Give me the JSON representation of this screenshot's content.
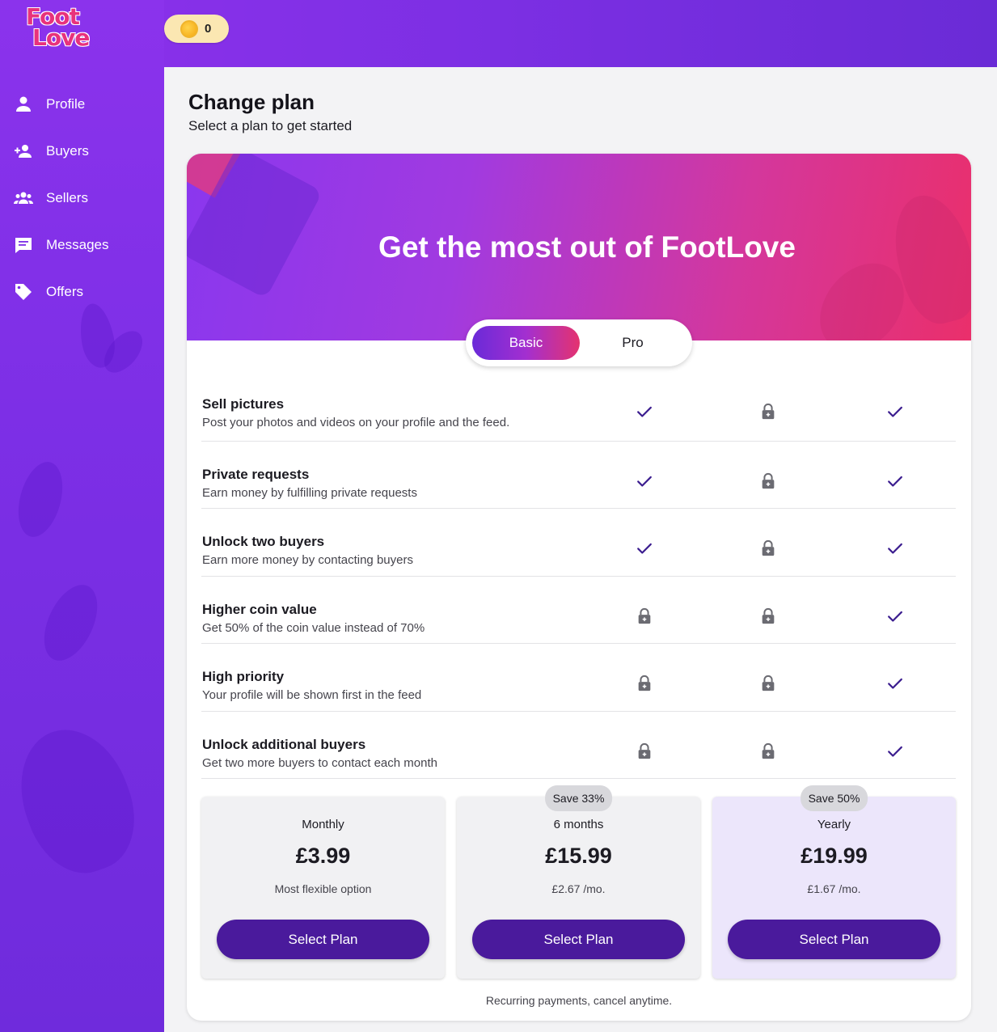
{
  "app": {
    "logo_line1": "Foot",
    "logo_line2": "Love"
  },
  "coins": {
    "count": "0",
    "icon": "coin-icon"
  },
  "sidebar": {
    "items": [
      {
        "label": "Profile",
        "icon": "person-icon"
      },
      {
        "label": "Buyers",
        "icon": "buyers-icon"
      },
      {
        "label": "Sellers",
        "icon": "group-icon"
      },
      {
        "label": "Messages",
        "icon": "message-icon"
      },
      {
        "label": "Offers",
        "icon": "tag-icon"
      }
    ]
  },
  "page": {
    "title": "Change plan",
    "subtitle": "Select a plan to get started"
  },
  "hero": {
    "title": "Get the most out of FootLove"
  },
  "toggle": {
    "options": [
      "Basic",
      "Pro"
    ],
    "selected": "Basic"
  },
  "features": [
    {
      "title": "Sell pictures",
      "desc": "Post your photos and videos on your profile and the feed.",
      "cols": [
        "check",
        "lock",
        "check"
      ]
    },
    {
      "title": "Private requests",
      "desc": "Earn money by fulfilling private requests",
      "cols": [
        "check",
        "lock",
        "check"
      ]
    },
    {
      "title": "Unlock two buyers",
      "desc": "Earn more money by contacting buyers",
      "cols": [
        "check",
        "lock",
        "check"
      ]
    },
    {
      "title": "Higher coin value",
      "desc": "Get 50% of the coin value instead of 70%",
      "cols": [
        "lock",
        "lock",
        "check"
      ]
    },
    {
      "title": "High priority",
      "desc": "Your profile will be shown first in the feed",
      "cols": [
        "lock",
        "lock",
        "check"
      ]
    },
    {
      "title": "Unlock additional buyers",
      "desc": "Get two more buyers to contact each month",
      "cols": [
        "lock",
        "lock",
        "check"
      ]
    }
  ],
  "plans": [
    {
      "badge": "",
      "period": "Monthly",
      "price": "£3.99",
      "note": "Most flexible option",
      "button": "Select Plan"
    },
    {
      "badge": "Save 33%",
      "period": "6 months",
      "price": "£15.99",
      "note": "£2.67 /mo.",
      "button": "Select Plan"
    },
    {
      "badge": "Save 50%",
      "period": "Yearly",
      "price": "£19.99",
      "note": "£1.67 /mo.",
      "button": "Select Plan"
    }
  ],
  "footnote": "Recurring payments, cancel anytime.",
  "colors": {
    "primary": "#4a1a9c",
    "check": "#3b1d8f",
    "lock": "#6b6b72",
    "highlight_plan": "#ece6fb"
  }
}
